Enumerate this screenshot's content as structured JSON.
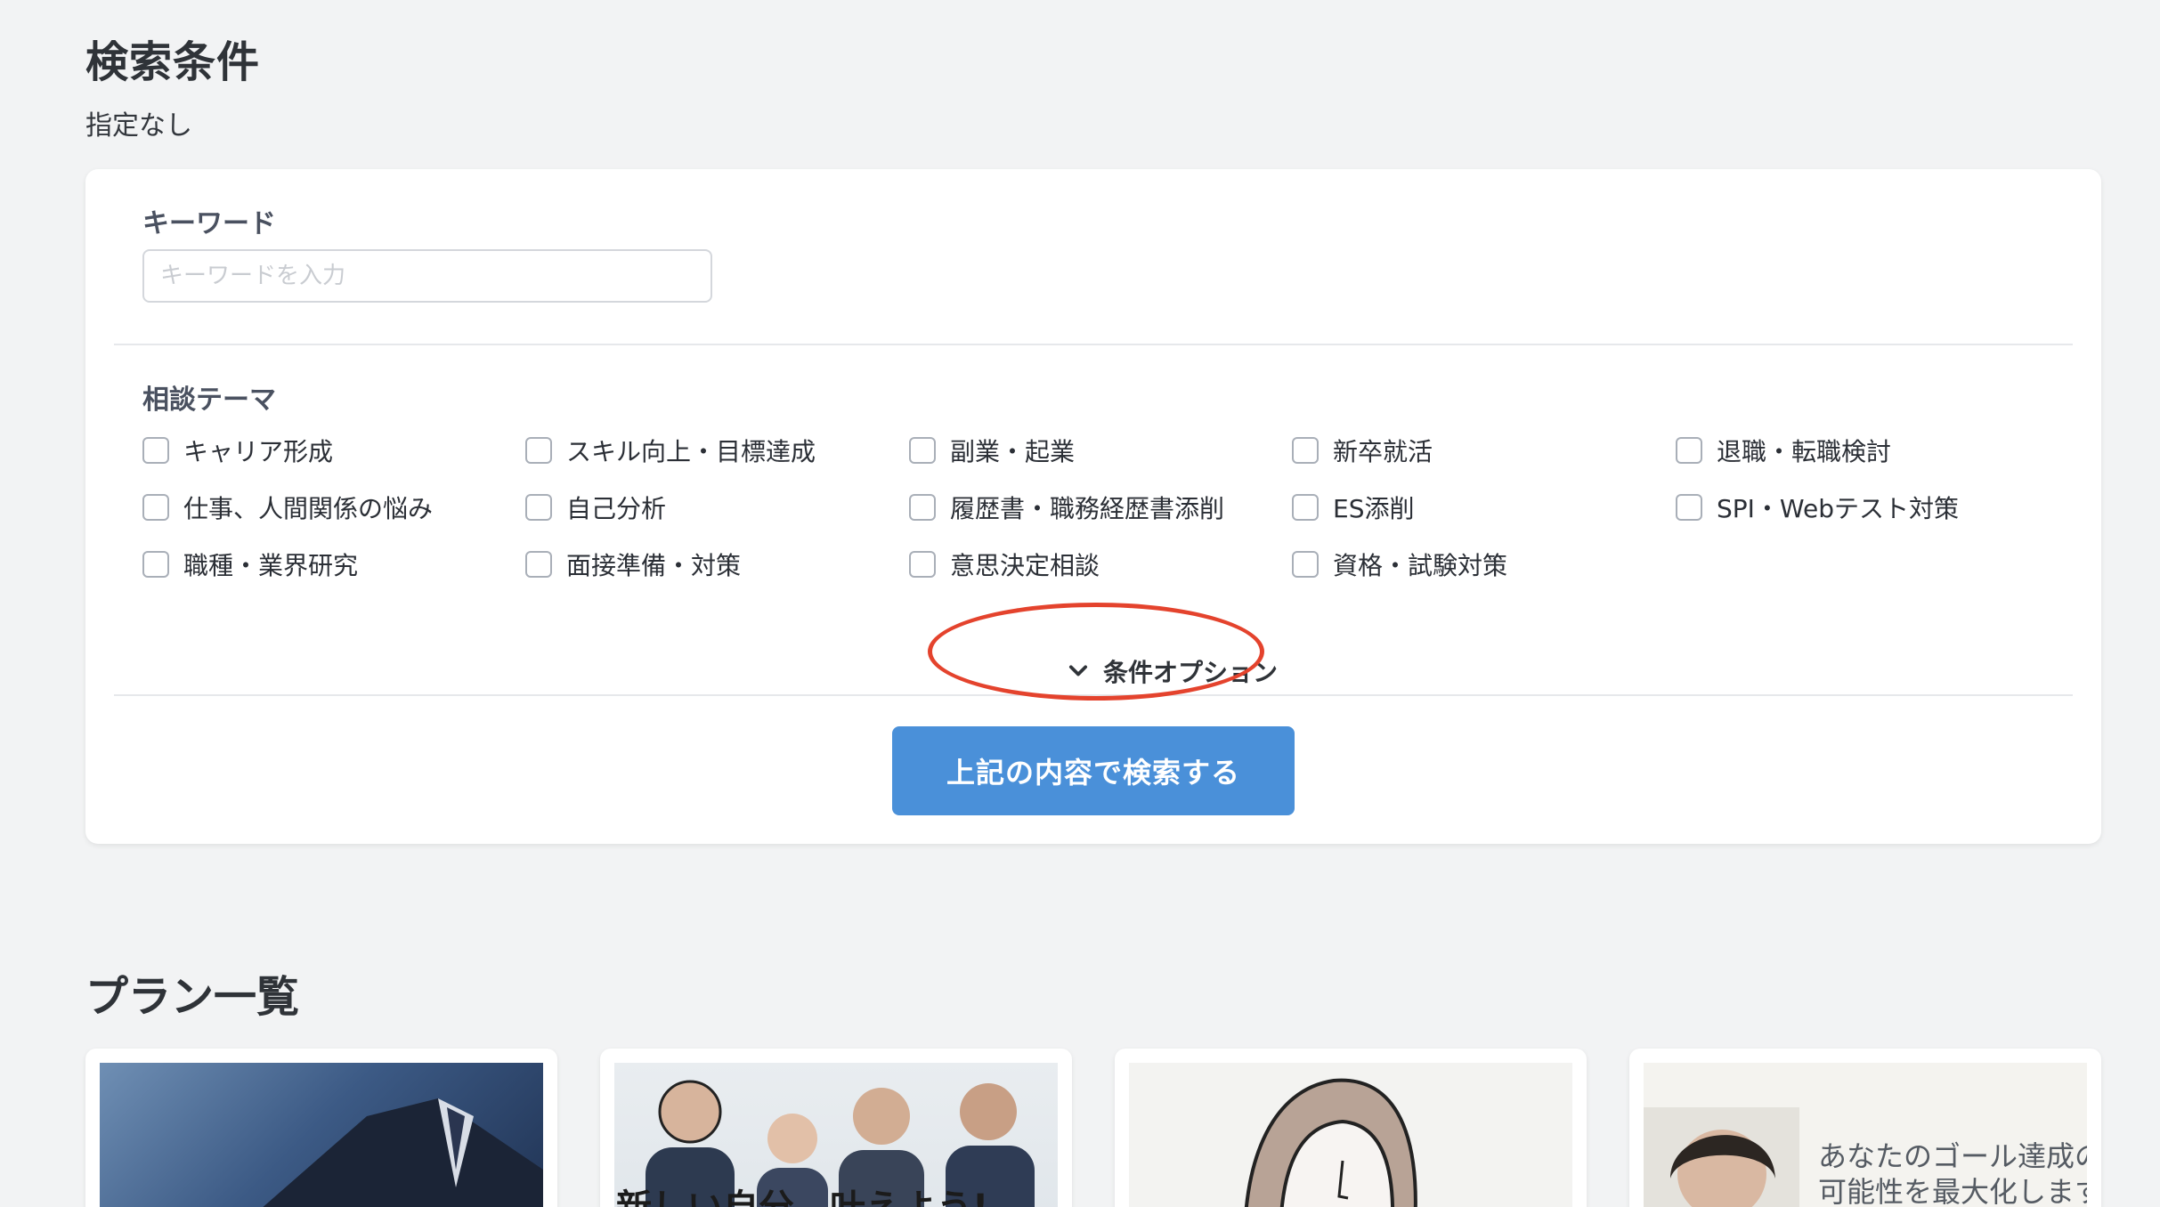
{
  "header": {
    "title": "検索条件",
    "summary": "指定なし"
  },
  "keyword": {
    "label": "キーワード",
    "placeholder": "キーワードを入力",
    "value": ""
  },
  "themes": {
    "label": "相談テーマ",
    "items": [
      {
        "label": "キャリア形成",
        "checked": false
      },
      {
        "label": "スキル向上・目標達成",
        "checked": false
      },
      {
        "label": "副業・起業",
        "checked": false
      },
      {
        "label": "新卒就活",
        "checked": false
      },
      {
        "label": "退職・転職検討",
        "checked": false
      },
      {
        "label": "仕事、人間関係の悩み",
        "checked": false
      },
      {
        "label": "自己分析",
        "checked": false
      },
      {
        "label": "履歴書・職務経歴書添削",
        "checked": false
      },
      {
        "label": "ES添削",
        "checked": false
      },
      {
        "label": "SPI・Webテスト対策",
        "checked": false
      },
      {
        "label": "職種・業界研究",
        "checked": false
      },
      {
        "label": "面接準備・対策",
        "checked": false
      },
      {
        "label": "意思決定相談",
        "checked": false
      },
      {
        "label": "資格・試験対策",
        "checked": false
      }
    ]
  },
  "options": {
    "label": "条件オプション",
    "icon": "chevron-down-icon",
    "highlight_color": "#e4432d"
  },
  "search_button": {
    "label": "上記の内容で検索する",
    "color": "#4a90d9"
  },
  "plans": {
    "title": "プラン一覧",
    "cards": [
      {
        "thumb_text": ""
      },
      {
        "thumb_text": "新しい自分、叶えよう!"
      },
      {
        "thumb_text": ""
      },
      {
        "thumb_text_line1": "あなたのゴール達成の",
        "thumb_text_line2": "可能性を最大化します"
      }
    ]
  }
}
